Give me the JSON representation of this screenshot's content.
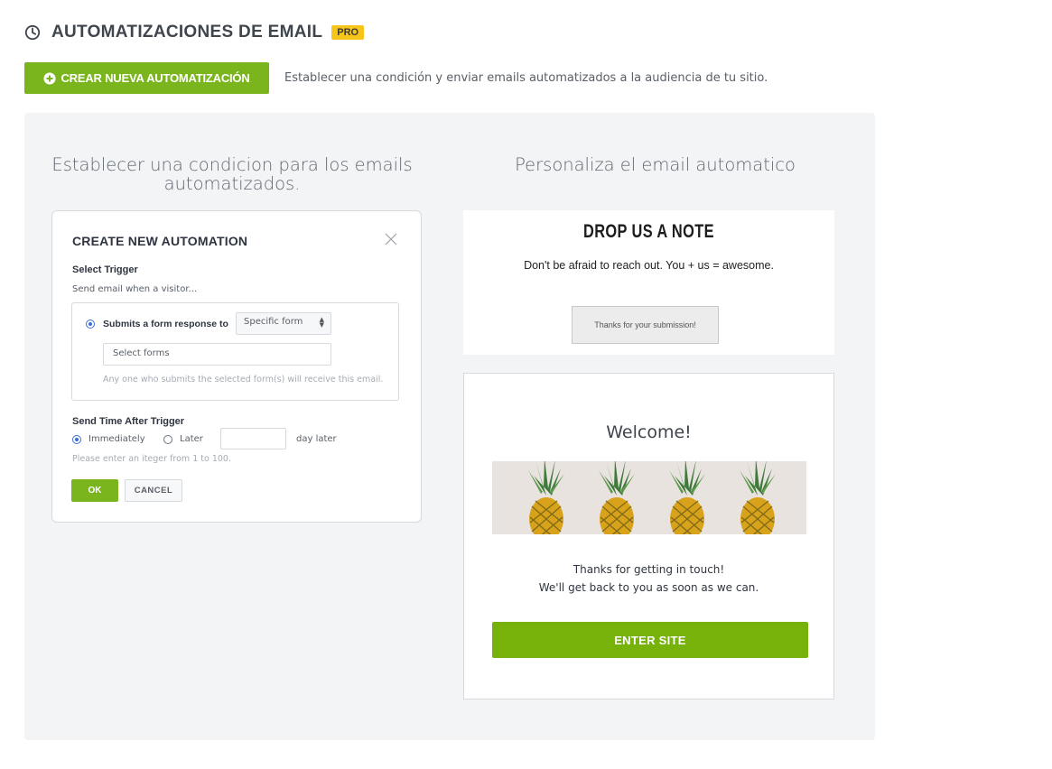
{
  "header": {
    "title": "AUTOMATIZACIONES DE EMAIL",
    "badge": "PRO",
    "icon": "clock-icon"
  },
  "actions": {
    "create_label": "CREAR NUEVA AUTOMATIZACIÓN",
    "description": "Establecer una condición y enviar emails automatizados a la audiencia de tu sitio."
  },
  "left_column": {
    "title": "Establecer una condicion para los emails automatizados."
  },
  "right_column": {
    "title": "Personaliza el email automatico"
  },
  "modal": {
    "title": "CREATE NEW AUTOMATION",
    "select_trigger_label": "Select Trigger",
    "send_email_when": "Send email when a visitor...",
    "submits_label": "Submits a form response to",
    "form_select_value": "Specific form",
    "forms_input_value": "Select forms",
    "forms_hint": "Any one who submits the selected form(s) will receive this email.",
    "send_time_label": "Send Time After Trigger",
    "immediately_label": "Immediately",
    "later_label": "Later",
    "day_later_label": "day later",
    "integer_hint": "Please enter an iteger  from 1 to 100.",
    "ok_label": "OK",
    "cancel_label": "CANCEL"
  },
  "email_preview": {
    "drop_title": "DROP US A NOTE",
    "drop_subtitle": "Don't be afraid to reach out. You + us = awesome.",
    "thanks_box": "Thanks for your submission!",
    "welcome": "Welcome!",
    "message_line1": "Thanks for getting in touch!",
    "message_line2": "We'll get back to you as soon as we can.",
    "enter_label": "ENTER SITE"
  },
  "colors": {
    "accent_green": "#7ab51d",
    "badge_yellow": "#f7c418",
    "radio_blue": "#3a6fd8"
  }
}
